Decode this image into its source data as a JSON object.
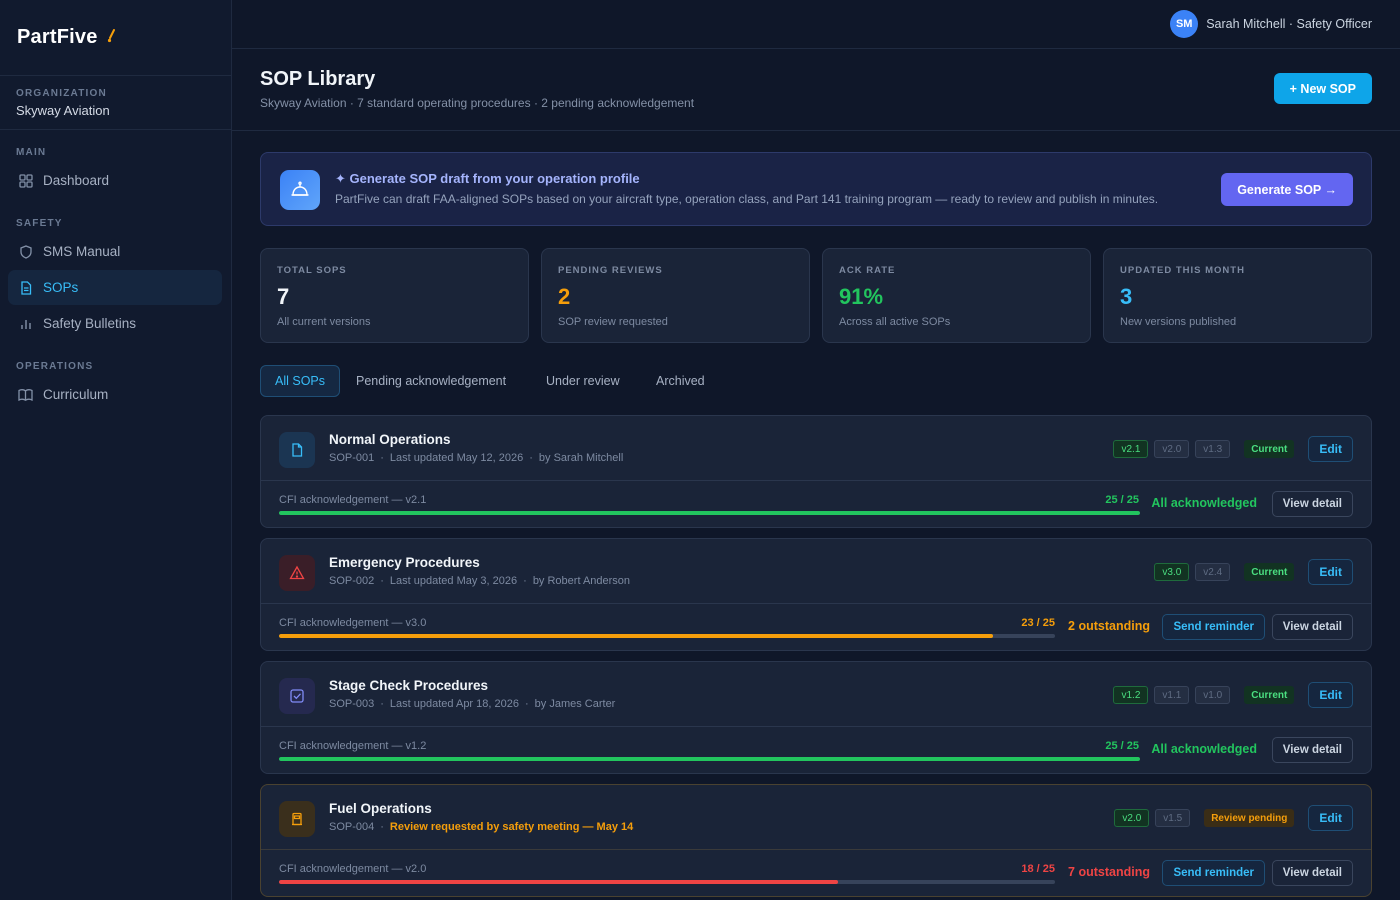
{
  "brand": {
    "name": "PartFive"
  },
  "org": {
    "label": "ORGANIZATION",
    "name": "Skyway Aviation"
  },
  "nav": {
    "main_label": "MAIN",
    "dashboard": "Dashboard",
    "safety_label": "SAFETY",
    "sms_manual": "SMS Manual",
    "sops": "SOPs",
    "safety_bulletins": "Safety Bulletins",
    "operations_label": "OPERATIONS",
    "curriculum": "Curriculum"
  },
  "user": {
    "initials": "SM",
    "display": "Sarah Mitchell · Safety Officer"
  },
  "header": {
    "title": "SOP Library",
    "subtitle": "Skyway Aviation · 7 standard operating procedures · 2 pending acknowledgement",
    "new_button": "+ New SOP"
  },
  "banner": {
    "title": "✦ Generate SOP draft from your operation profile",
    "text": "PartFive can draft FAA-aligned SOPs based on your aircraft type, operation class, and Part 141 training program — ready to review and publish in minutes.",
    "button": "Generate SOP →"
  },
  "stats": [
    {
      "label": "TOTAL SOPS",
      "value": "7",
      "note": "All current versions",
      "color": "#f1f5f9"
    },
    {
      "label": "PENDING REVIEWS",
      "value": "2",
      "note": "SOP review requested",
      "color": "#f59e0b"
    },
    {
      "label": "ACK RATE",
      "value": "91%",
      "note": "Across all active SOPs",
      "color": "#22c55e"
    },
    {
      "label": "UPDATED THIS MONTH",
      "value": "3",
      "note": "New versions published",
      "color": "#38bdf8"
    }
  ],
  "tabs": [
    "All SOPs",
    "Pending acknowledgement",
    "Under review",
    "Archived"
  ],
  "sops": [
    {
      "title": "Normal Operations",
      "id": "SOP-001",
      "updated": "Last updated May 12, 2026",
      "author": "by Sarah Mitchell",
      "versions": [
        "v2.1",
        "v2.0",
        "v1.3"
      ],
      "status": "Current",
      "edit": "Edit",
      "ack_label": "CFI acknowledgement — v2.1",
      "ack_count": "25 / 25",
      "ack_fraction": 1.0,
      "ack_status": "All acknowledged",
      "view": "View detail"
    },
    {
      "title": "Emergency Procedures",
      "id": "SOP-002",
      "updated": "Last updated May 3, 2026",
      "author": "by Robert Anderson",
      "versions": [
        "v3.0",
        "v2.4"
      ],
      "status": "Current",
      "edit": "Edit",
      "ack_label": "CFI acknowledgement — v3.0",
      "ack_count": "23 / 25",
      "ack_fraction": 0.92,
      "ack_status": "2 outstanding",
      "remind": "Send reminder",
      "view": "View detail"
    },
    {
      "title": "Stage Check Procedures",
      "id": "SOP-003",
      "updated": "Last updated Apr 18, 2026",
      "author": "by James Carter",
      "versions": [
        "v1.2",
        "v1.1",
        "v1.0"
      ],
      "status": "Current",
      "edit": "Edit",
      "ack_label": "CFI acknowledgement — v1.2",
      "ack_count": "25 / 25",
      "ack_fraction": 1.0,
      "ack_status": "All acknowledged",
      "view": "View detail"
    },
    {
      "title": "Fuel Operations",
      "id": "SOP-004",
      "review_note": "Review requested by safety meeting — May 14",
      "versions": [
        "v2.0",
        "v1.5"
      ],
      "status": "Review pending",
      "edit": "Edit",
      "ack_label": "CFI acknowledgement — v2.0",
      "ack_count": "18 / 25",
      "ack_fraction": 0.72,
      "ack_status": "7 outstanding",
      "remind": "Send reminder",
      "view": "View detail"
    }
  ],
  "colors": {
    "accent": "#0ea5e9",
    "success": "#22c55e",
    "warning": "#f59e0b",
    "danger": "#ef4444",
    "indigo": "#6366f1"
  }
}
